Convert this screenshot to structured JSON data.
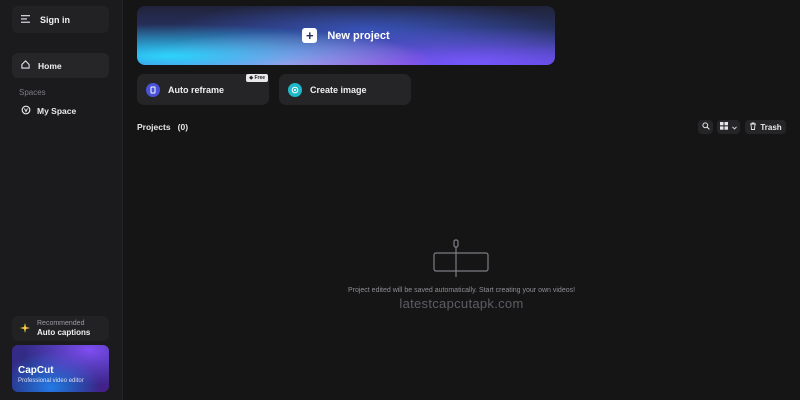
{
  "sidebar": {
    "signin_label": "Sign in",
    "home_label": "Home",
    "spaces_label": "Spaces",
    "myspace_label": "My Space",
    "recommended": {
      "small": "Recommended",
      "title": "Auto captions"
    },
    "promo": {
      "title": "CapCut",
      "subtitle": "Professional video editor"
    }
  },
  "hero": {
    "label": "New project",
    "icon": "plus-icon"
  },
  "tools": [
    {
      "label": "Auto reframe",
      "icon": "reframe-icon",
      "badge": "Free",
      "icon_color": "#4a52d8"
    },
    {
      "label": "Create image",
      "icon": "image-icon",
      "icon_color": "#1fb8c8"
    }
  ],
  "projects": {
    "label": "Projects",
    "count": "(0)"
  },
  "toolbar": {
    "trash_label": "Trash"
  },
  "empty_state": {
    "message": "Project edited will be saved automatically. Start creating your own videos!"
  },
  "watermark": "latestcapcutapk.com",
  "colors": {
    "background": "#151516",
    "sidebar": "#1b1b1d",
    "card": "#252528"
  }
}
